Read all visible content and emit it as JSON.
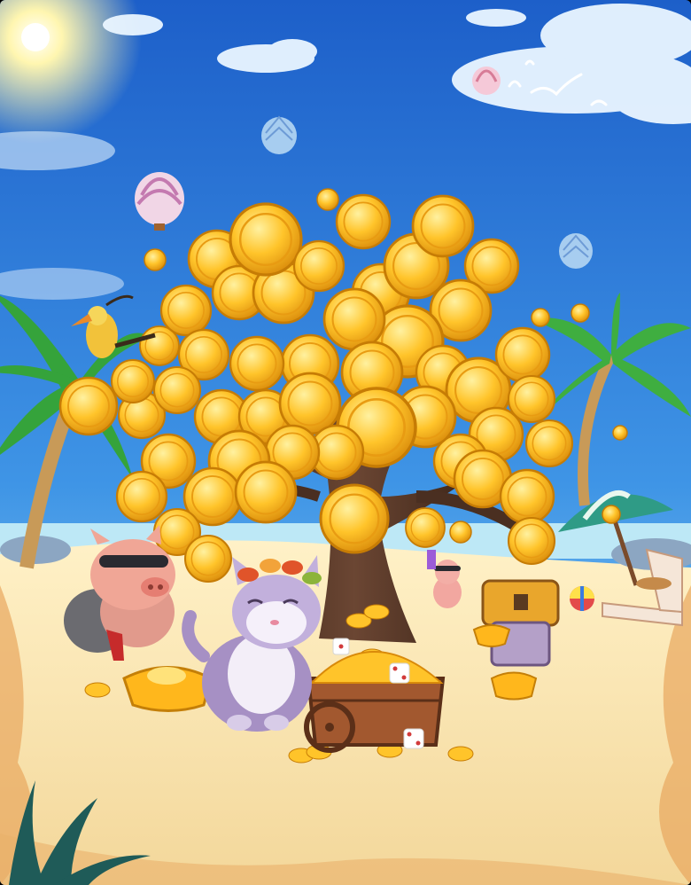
{
  "scene": {
    "sky_top": "#1d5fc9",
    "sky_bottom": "#8fd3f4",
    "sand": "#f6e2b0",
    "sand_shadow": "#e7b877",
    "coin_gold": "#ffbe1f",
    "coin_dark": "#d98a0a",
    "trunk": "#5a3a2c"
  },
  "elements": [
    "sun-icon",
    "cloud-icon",
    "hot-air-balloon-icon",
    "seagull-icon",
    "palm-tree-icon",
    "money-tree-icon",
    "gold-coin-icon",
    "toucan-bird-icon",
    "pig-bandit-character",
    "cat-character",
    "treasure-cart-icon",
    "treasure-chest-icon",
    "gold-ingot-icon",
    "beach-umbrella-icon",
    "lounge-chair-icon",
    "beach-ball-icon",
    "dice-icon"
  ]
}
